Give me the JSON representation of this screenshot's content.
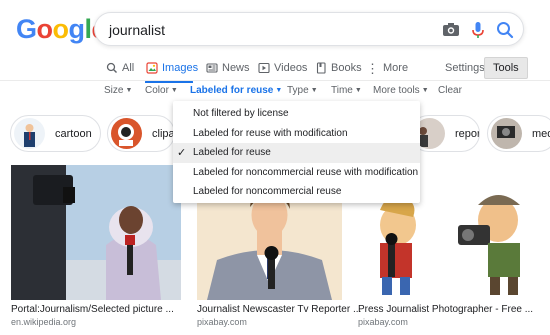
{
  "header": {
    "logo": [
      "G",
      "o",
      "o",
      "g",
      "l",
      "e"
    ],
    "logo_colors": [
      "#4285f4",
      "#ea4335",
      "#fbbc05",
      "#4285f4",
      "#34a853",
      "#ea4335"
    ],
    "search_query": "journalist",
    "icons": [
      "camera-icon",
      "microphone-icon",
      "search-icon"
    ]
  },
  "tabs": [
    {
      "label": "All",
      "icon": "search-icon"
    },
    {
      "label": "Images",
      "icon": "images-icon",
      "active": true
    },
    {
      "label": "News",
      "icon": "news-icon"
    },
    {
      "label": "Videos",
      "icon": "play-icon"
    },
    {
      "label": "Books",
      "icon": "book-icon"
    },
    {
      "label": "More",
      "icon": "more-icon"
    }
  ],
  "tools": {
    "settings": "Settings",
    "tools": "Tools"
  },
  "filters": [
    {
      "label": "Size"
    },
    {
      "label": "Color"
    },
    {
      "label": "Labeled for reuse",
      "active": true
    },
    {
      "label": "Type"
    },
    {
      "label": "Time"
    },
    {
      "label": "More tools"
    },
    {
      "label": "Clear"
    }
  ],
  "dropdown": {
    "items": [
      "Not filtered by license",
      "Labeled for reuse with modification",
      "Labeled for reuse",
      "Labeled for noncommercial reuse with modification",
      "Labeled for noncommercial reuse"
    ],
    "selected_index": 2
  },
  "chips": [
    {
      "label": "cartoon"
    },
    {
      "label": "clipart"
    },
    {
      "label": "reporter"
    },
    {
      "label": "med"
    }
  ],
  "results": [
    {
      "title": "Portal:Journalism/Selected picture ...",
      "source": "en.wikipedia.org"
    },
    {
      "title": "Journalist Newscaster Tv Reporter ...",
      "source": "pixabay.com"
    },
    {
      "title": "Press Journalist Photographer - Free ...",
      "source": "pixabay.com"
    }
  ],
  "colors": {
    "accent": "#1a73e8",
    "text": "#202124",
    "muted": "#5f6368"
  }
}
